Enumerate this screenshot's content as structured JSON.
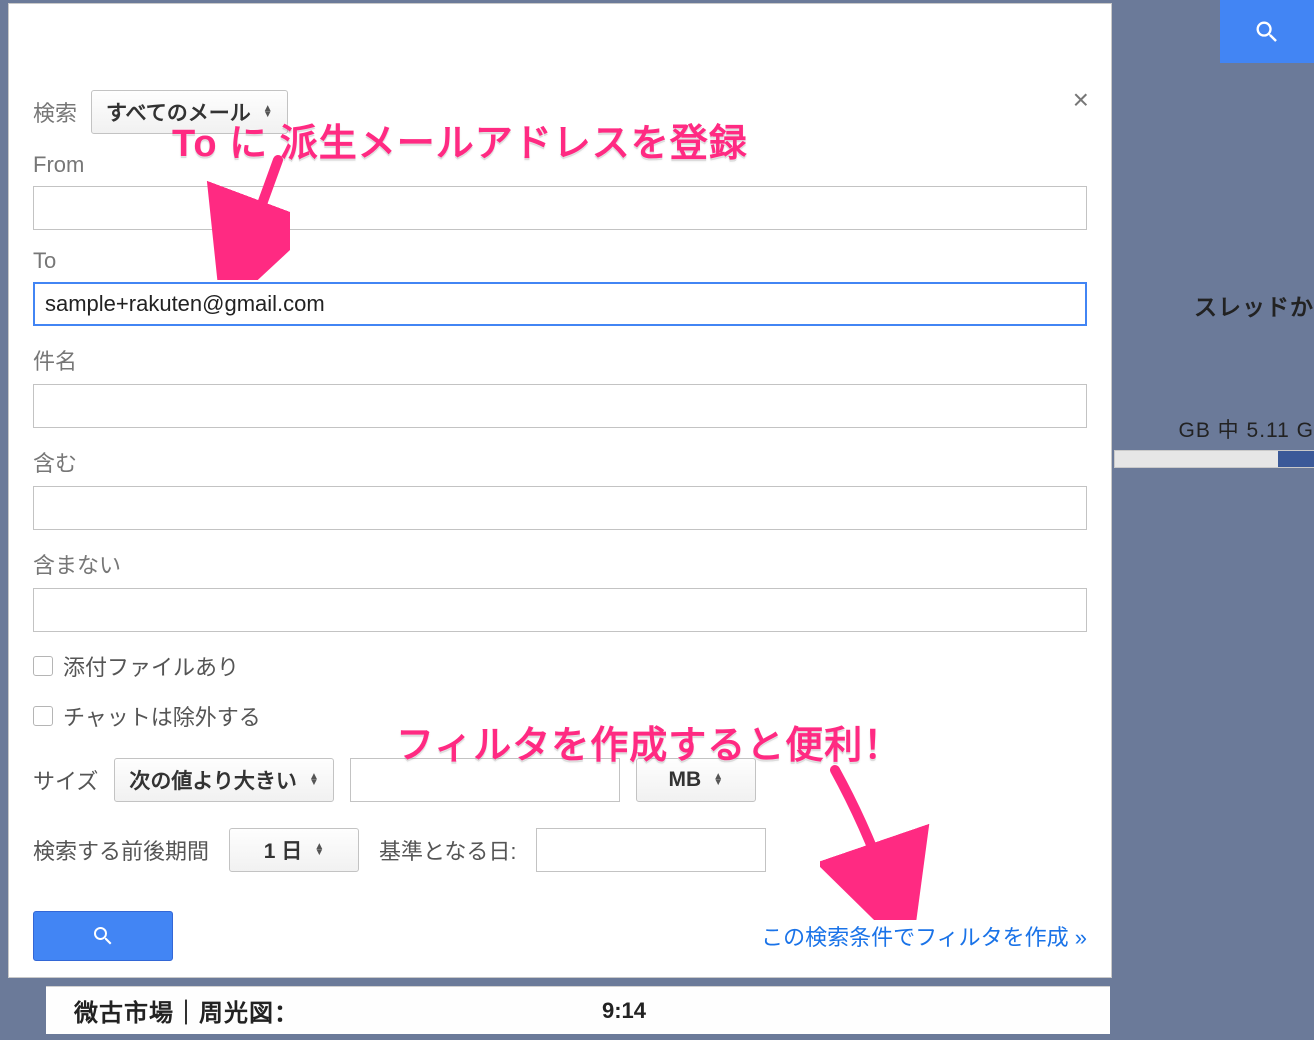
{
  "top_search_button": {
    "aria": "search"
  },
  "background": {
    "thread_fragment": "スレッドか",
    "storage_fragment": "GB 中 5.11 G"
  },
  "panel": {
    "close_glyph": "×",
    "scope": {
      "label": "検索",
      "selected": "すべてのメール"
    },
    "from": {
      "label": "From",
      "value": ""
    },
    "to": {
      "label": "To",
      "value": "sample+rakuten@gmail.com"
    },
    "subject": {
      "label": "件名",
      "value": ""
    },
    "has_words": {
      "label": "含む",
      "value": ""
    },
    "not_words": {
      "label": "含まない",
      "value": ""
    },
    "has_attachment": {
      "label": "添付ファイルあり",
      "checked": false
    },
    "exclude_chats": {
      "label": "チャットは除外する",
      "checked": false
    },
    "size": {
      "label": "サイズ",
      "comparator": "次の値より大きい",
      "value": "",
      "unit": "MB"
    },
    "date": {
      "label_range": "検索する前後期間",
      "range_selected": "1 日",
      "label_base": "基準となる日:",
      "base_value": ""
    },
    "search_button": {
      "aria": "search"
    },
    "create_filter_link": "この検索条件でフィルタを作成 »"
  },
  "annotations": {
    "to_hint": "To に 派生メールアドレスを登録",
    "filter_hint": "フィルタを作成すると便利！"
  },
  "below": {
    "col1": "微古市場｜周光図：",
    "col2": "9:14"
  }
}
